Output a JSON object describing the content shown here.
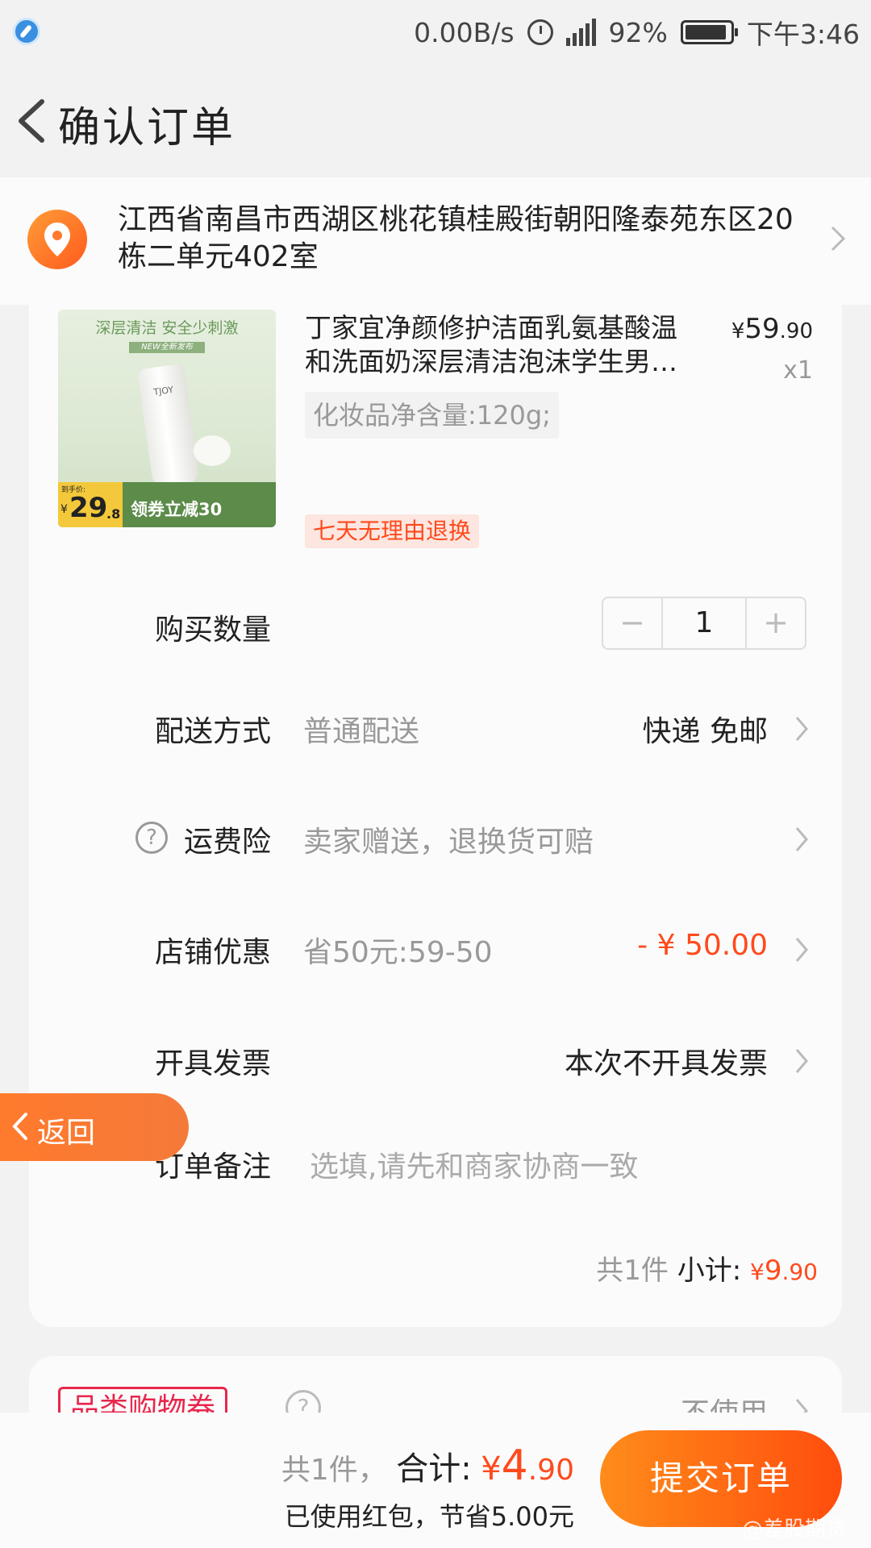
{
  "status_bar": {
    "speed": "0.00B/s",
    "network": "4G",
    "battery": "92%",
    "time": "下午3:46"
  },
  "header": {
    "title": "确认订单"
  },
  "address": {
    "text": "江西省南昌市西湖区桃花镇桂殿街朝阳隆泰苑东区20栋二单元402室"
  },
  "product": {
    "image": {
      "headline": "深层清洁  安全少刺激",
      "badge": "NEW全新发布",
      "brand": "TJOY",
      "price_label": "到手价:",
      "price_yen": "¥",
      "price_int": "29",
      "price_dec": ".8",
      "coupon": "领券立减30"
    },
    "title": "丁家宜净颜修护洁面乳氨基酸温和洗面奶深层清洁泡沫学生男女士",
    "price_symbol": "¥",
    "price_int": "59",
    "price_dec": ".90",
    "quantity": "x1",
    "spec": "化妆品净含量:120g;",
    "tag": "七天无理由退换"
  },
  "rows": {
    "quantity": {
      "label": "购买数量",
      "value": "1",
      "minus": "−",
      "plus": "+"
    },
    "delivery": {
      "label": "配送方式",
      "sub": "普通配送",
      "value": "快递 免邮"
    },
    "insurance": {
      "label": "运费险",
      "sub": "卖家赠送，退换货可赔"
    },
    "discount": {
      "label": "店铺优惠",
      "sub": "省50元:59-50",
      "value": "- ¥ 50.00"
    },
    "invoice": {
      "label": "开具发票",
      "value": "本次不开具发票"
    },
    "note": {
      "label": "订单备注",
      "placeholder": "选填,请先和商家协商一致"
    }
  },
  "subtotal": {
    "count": "共1件",
    "label": "小计:",
    "yen": "¥",
    "int": "9",
    "dec": ".90"
  },
  "coupon": {
    "tag": "品类购物券",
    "value": "不使用"
  },
  "float_back": {
    "label": "返回"
  },
  "bottom": {
    "count": "共1件，",
    "total_label": "合计:",
    "yen": "¥",
    "int": "4",
    "dec": ".90",
    "saved": "已使用红包，节省5.00元",
    "submit": "提交订单",
    "watermark": "@差股期货"
  },
  "colors": {
    "accent": "#ff4a1c",
    "button_start": "#ff8c1a",
    "button_end": "#ff4d0d",
    "coupon_red": "#e8264c"
  }
}
